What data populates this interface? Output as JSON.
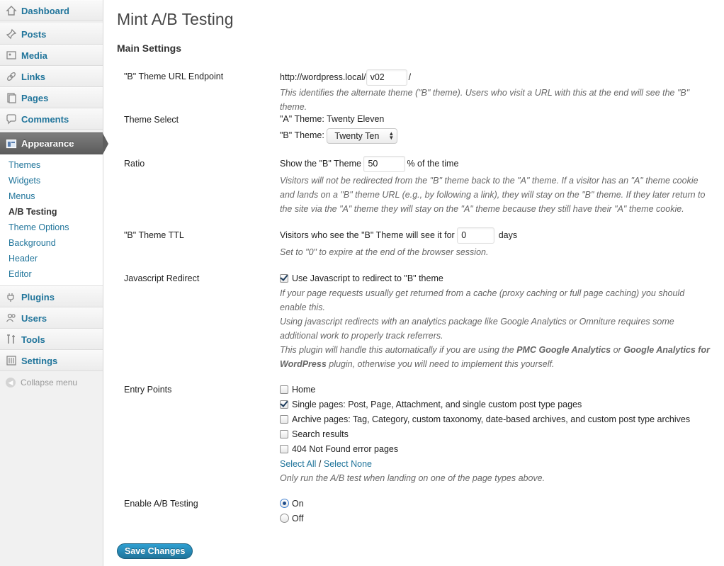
{
  "sidebar": {
    "dashboard": "Dashboard",
    "posts": "Posts",
    "media": "Media",
    "links": "Links",
    "pages": "Pages",
    "comments": "Comments",
    "appearance": "Appearance",
    "appearance_sub": [
      "Themes",
      "Widgets",
      "Menus",
      "A/B Testing",
      "Theme Options",
      "Background",
      "Header",
      "Editor"
    ],
    "plugins": "Plugins",
    "users": "Users",
    "tools": "Tools",
    "settings": "Settings",
    "collapse": "Collapse menu"
  },
  "page": {
    "title": "Mint A/B Testing",
    "section": "Main Settings"
  },
  "endpoint": {
    "label": "\"B\" Theme URL Endpoint",
    "prefix": "http://wordpress.local/",
    "value": "v02",
    "suffix": "/",
    "desc": "This identifies the alternate theme (\"B\" theme). Users who visit a URL with this at the end will see the \"B\" theme."
  },
  "theme_select": {
    "label": "Theme Select",
    "a_theme": "\"A\" Theme: Twenty Eleven",
    "b_label": "\"B\" Theme:",
    "b_value": "Twenty Ten"
  },
  "ratio": {
    "label": "Ratio",
    "prefix": "Show the \"B\" Theme",
    "value": "50",
    "suffix": "% of the time",
    "desc": "Visitors will not be redirected from the \"B\" theme back to the \"A\" theme. If a visitor has an \"A\" theme cookie and lands on a \"B\" theme URL (e.g., by following a link), they will stay on the \"B\" theme. If they later return to the site via the \"A\" theme they will stay on the \"A\" theme because they still have their \"A\" theme cookie."
  },
  "ttl": {
    "label": "\"B\" Theme TTL",
    "prefix": "Visitors who see the \"B\" Theme will see it for",
    "value": "0",
    "suffix": "days",
    "desc": "Set to \"0\" to expire at the end of the browser session."
  },
  "js_redirect": {
    "label": "Javascript Redirect",
    "checkbox_label": "Use Javascript to redirect to \"B\" theme",
    "checked": true,
    "desc1": "If your page requests usually get returned from a cache (proxy caching or full page caching) you should enable this.",
    "desc2": "Using javascript redirects with an analytics package like Google Analytics or Omniture requires some additional work to properly track referrers.",
    "desc3_a": "This plugin will handle this automatically if you are using the ",
    "desc3_b": "PMC Google Analytics",
    "desc3_c": " or ",
    "desc3_d": "Google Analytics for WordPress",
    "desc3_e": " plugin, otherwise you will need to implement this yourself."
  },
  "entry_points": {
    "label": "Entry Points",
    "options": [
      {
        "label": "Home",
        "checked": false
      },
      {
        "label": "Single pages: Post, Page, Attachment, and single custom post type pages",
        "checked": true
      },
      {
        "label": "Archive pages: Tag, Category, custom taxonomy, date-based archives, and custom post type archives",
        "checked": false
      },
      {
        "label": "Search results",
        "checked": false
      },
      {
        "label": "404 Not Found error pages",
        "checked": false
      }
    ],
    "select_all": "Select All",
    "separator": "/",
    "select_none": "Select None",
    "desc": "Only run the A/B test when landing on one of the page types above."
  },
  "enable": {
    "label": "Enable A/B Testing",
    "on": "On",
    "off": "Off",
    "selected": "On"
  },
  "save_label": "Save Changes"
}
